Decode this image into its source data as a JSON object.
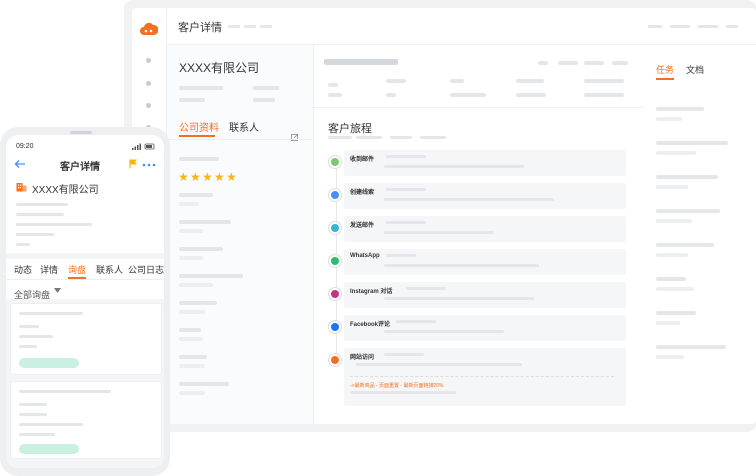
{
  "desktop": {
    "header_title": "客户详情",
    "company_name": "XXXX有限公司",
    "tabs": [
      "公司资料",
      "联系人"
    ],
    "rating_stars": 5,
    "journey_title": "客户旅程",
    "journey_events": [
      {
        "label": "收到邮件",
        "icon": "mail-in-icon",
        "color": "#7bc96f"
      },
      {
        "label": "创建线索",
        "icon": "lead-icon",
        "color": "#4a8cf7"
      },
      {
        "label": "发送邮件",
        "icon": "mail-out-icon",
        "color": "#35b4d6"
      },
      {
        "label": "WhatsApp",
        "icon": "whatsapp-icon",
        "color": "#25c26e"
      },
      {
        "label": "Instagram 对话",
        "icon": "instagram-icon",
        "color": "#c13584"
      },
      {
        "label": "Facebook评论",
        "icon": "facebook-icon",
        "color": "#1877f2"
      },
      {
        "label": "网站访问",
        "icon": "website-icon",
        "color": "#f36f21"
      }
    ],
    "visit_highlight": "->最新商品 - 页面重置 - 最新页面链接20%",
    "right_tabs": [
      "任务",
      "文档"
    ]
  },
  "mobile": {
    "time": "09:20",
    "title": "客户详情",
    "company_name": "XXXX有限公司",
    "tabs": [
      "动态",
      "详情",
      "询盘",
      "联系人",
      "公司日志"
    ],
    "active_tab": "询盘",
    "filter_label": "全部询盘"
  },
  "colors": {
    "accent": "#f36f21",
    "brand": "#f36f21",
    "pill": "#c9f0e1"
  }
}
